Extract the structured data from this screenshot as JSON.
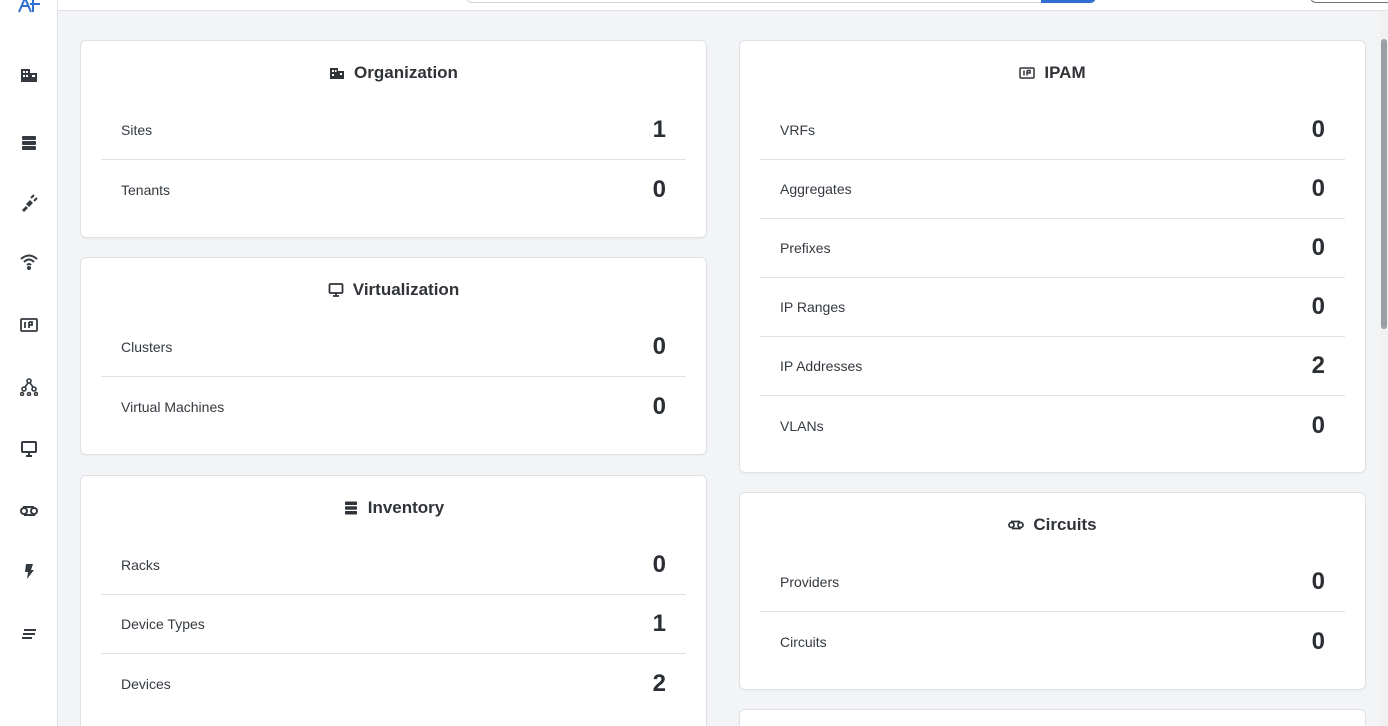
{
  "colors": {
    "accent": "#2f6fd1",
    "text": "#212529",
    "border": "#dee2e6",
    "background": "#f3f4f6"
  },
  "sidebar": {
    "logo": "netbox-logo-icon",
    "items": [
      {
        "name": "organization",
        "icon": "building-icon"
      },
      {
        "name": "devices",
        "icon": "server-icon"
      },
      {
        "name": "connections",
        "icon": "plug-icon"
      },
      {
        "name": "wireless",
        "icon": "wifi-icon"
      },
      {
        "name": "ipam",
        "icon": "ip-icon"
      },
      {
        "name": "overlay",
        "icon": "topology-icon"
      },
      {
        "name": "virtualization",
        "icon": "monitor-icon"
      },
      {
        "name": "circuits",
        "icon": "circuit-icon"
      },
      {
        "name": "power",
        "icon": "lightning-icon"
      },
      {
        "name": "other",
        "icon": "lines-icon"
      }
    ]
  },
  "cards": {
    "organization": {
      "title": "Organization",
      "rows": [
        {
          "label": "Sites",
          "value": "1"
        },
        {
          "label": "Tenants",
          "value": "0"
        }
      ]
    },
    "virtualization": {
      "title": "Virtualization",
      "rows": [
        {
          "label": "Clusters",
          "value": "0"
        },
        {
          "label": "Virtual Machines",
          "value": "0"
        }
      ]
    },
    "inventory": {
      "title": "Inventory",
      "rows": [
        {
          "label": "Racks",
          "value": "0"
        },
        {
          "label": "Device Types",
          "value": "1"
        },
        {
          "label": "Devices",
          "value": "2"
        }
      ]
    },
    "ipam": {
      "title": "IPAM",
      "rows": [
        {
          "label": "VRFs",
          "value": "0"
        },
        {
          "label": "Aggregates",
          "value": "0"
        },
        {
          "label": "Prefixes",
          "value": "0"
        },
        {
          "label": "IP Ranges",
          "value": "0"
        },
        {
          "label": "IP Addresses",
          "value": "2"
        },
        {
          "label": "VLANs",
          "value": "0"
        }
      ]
    },
    "circuits": {
      "title": "Circuits",
      "rows": [
        {
          "label": "Providers",
          "value": "0"
        },
        {
          "label": "Circuits",
          "value": "0"
        }
      ]
    }
  }
}
